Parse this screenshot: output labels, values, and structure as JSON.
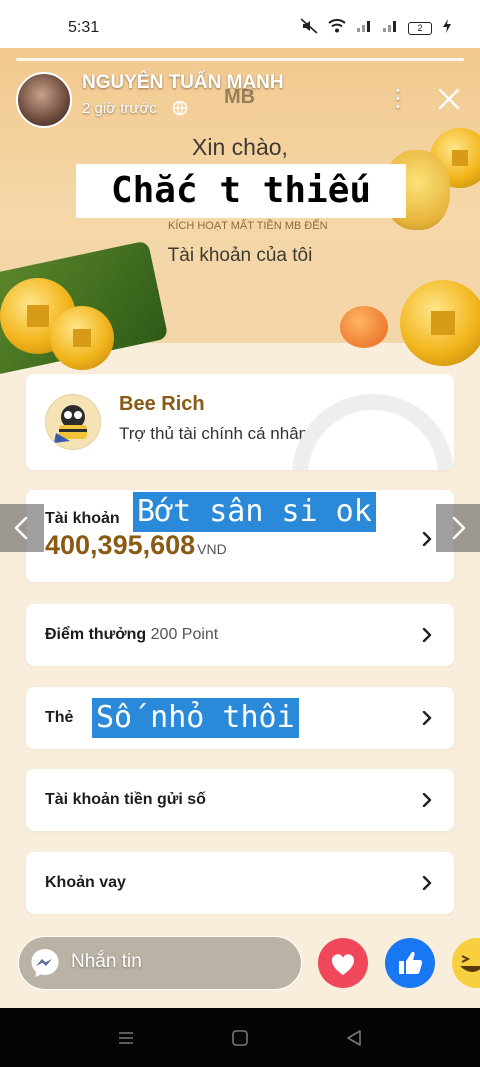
{
  "status_bar": {
    "time": "5:31",
    "battery": "2"
  },
  "story": {
    "user_name": "NGUYÊN TUẤN MẠNH",
    "time_ago": "2 giờ trước"
  },
  "screenshot": {
    "brand": "MB",
    "greeting": "Xin chào,",
    "caption_top": "Chắc t thiếu",
    "promo_line": "KÍCH HOẠT MẤT TIỀN MB ĐẾN",
    "section_title": "Tài khoản của tôi",
    "assistant": {
      "title": "Bee Rich",
      "subtitle": "Trợ thủ tài chính cá nhân"
    },
    "account": {
      "label": "Tài khoản",
      "balance": "400,395,608",
      "currency": "VND",
      "caption": "Bớt sân si ok"
    },
    "points": {
      "label": "Điểm thưởng",
      "value": "200 Point"
    },
    "card": {
      "label": "Thẻ",
      "caption": "Số nhỏ thôi"
    },
    "savings": {
      "label": "Tài khoản tiền gửi số"
    },
    "loan": {
      "label": "Khoản vay"
    }
  },
  "composer": {
    "placeholder": "Nhắn tin"
  },
  "icons": {
    "globe": "globe-icon",
    "more": "more-vertical-icon",
    "close": "close-icon",
    "chevron": "chevron-right-icon",
    "messenger": "messenger-icon",
    "heart": "heart-icon",
    "like": "thumbs-up-icon",
    "laugh": "laugh-emoji-icon"
  },
  "colors": {
    "accent_gold": "#8a5a14",
    "caption_blue": "#2a8ad9",
    "reaction_red": "#f0475a",
    "reaction_blue": "#1877f2"
  }
}
